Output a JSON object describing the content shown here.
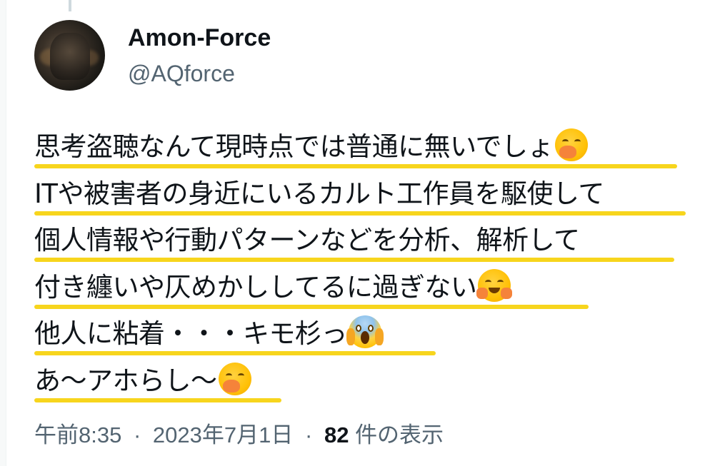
{
  "author": {
    "display_name": "Amon-Force",
    "handle": "@AQforce",
    "avatar_icon": "profile-avatar"
  },
  "tweet": {
    "lines": [
      {
        "text": "思考盗聴なんて現時点では普通に無いでしょ",
        "emoji": "yawning-face-icon"
      },
      {
        "text": "ITや被害者の身近にいるカルト工作員を駆使して",
        "emoji": null
      },
      {
        "text": "個人情報や行動パターンなどを分析、解析して",
        "emoji": null
      },
      {
        "text": "付き纏いや仄めかししてるに過ぎない",
        "emoji": "hugging-face-icon"
      },
      {
        "text": "他人に粘着・・・キモ杉っ",
        "emoji": "screaming-face-icon"
      },
      {
        "text": "あ〜アホらし〜",
        "emoji": "yawning-face-icon"
      }
    ],
    "highlight_color": "#f7d51d"
  },
  "meta": {
    "time": "午前8:35",
    "date": "2023年7月1日",
    "separator": "·",
    "views_count": "82",
    "views_label": "件の表示"
  }
}
